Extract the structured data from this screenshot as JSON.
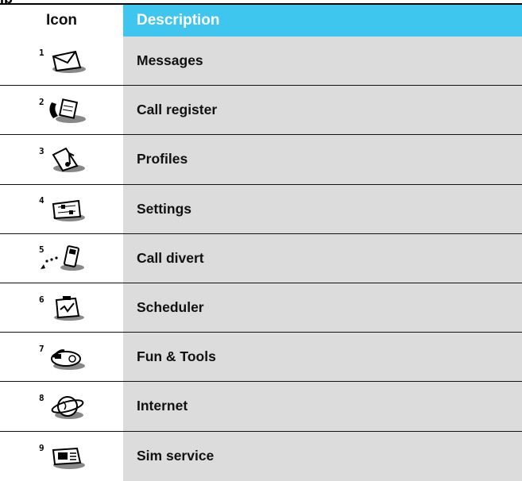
{
  "header": {
    "clipped_title": "Ip",
    "icon_col": "Icon",
    "desc_col": "Description"
  },
  "menu_items": [
    {
      "number": "1",
      "label": "Messages",
      "icon": "envelope-icon"
    },
    {
      "number": "2",
      "label": "Call register",
      "icon": "phone-note-icon"
    },
    {
      "number": "3",
      "label": "Profiles",
      "icon": "music-note-icon"
    },
    {
      "number": "4",
      "label": "Settings",
      "icon": "settings-sliders-icon"
    },
    {
      "number": "5",
      "label": "Call divert",
      "icon": "divert-phone-icon"
    },
    {
      "number": "6",
      "label": "Scheduler",
      "icon": "clipboard-icon"
    },
    {
      "number": "7",
      "label": "Fun & Tools",
      "icon": "gamepad-icon"
    },
    {
      "number": "8",
      "label": "Internet",
      "icon": "globe-icon"
    },
    {
      "number": "9",
      "label": "Sim service",
      "icon": "sim-card-icon"
    }
  ],
  "colors": {
    "header_accent": "#3fc6ef",
    "desc_bg": "#dcdcdc"
  }
}
